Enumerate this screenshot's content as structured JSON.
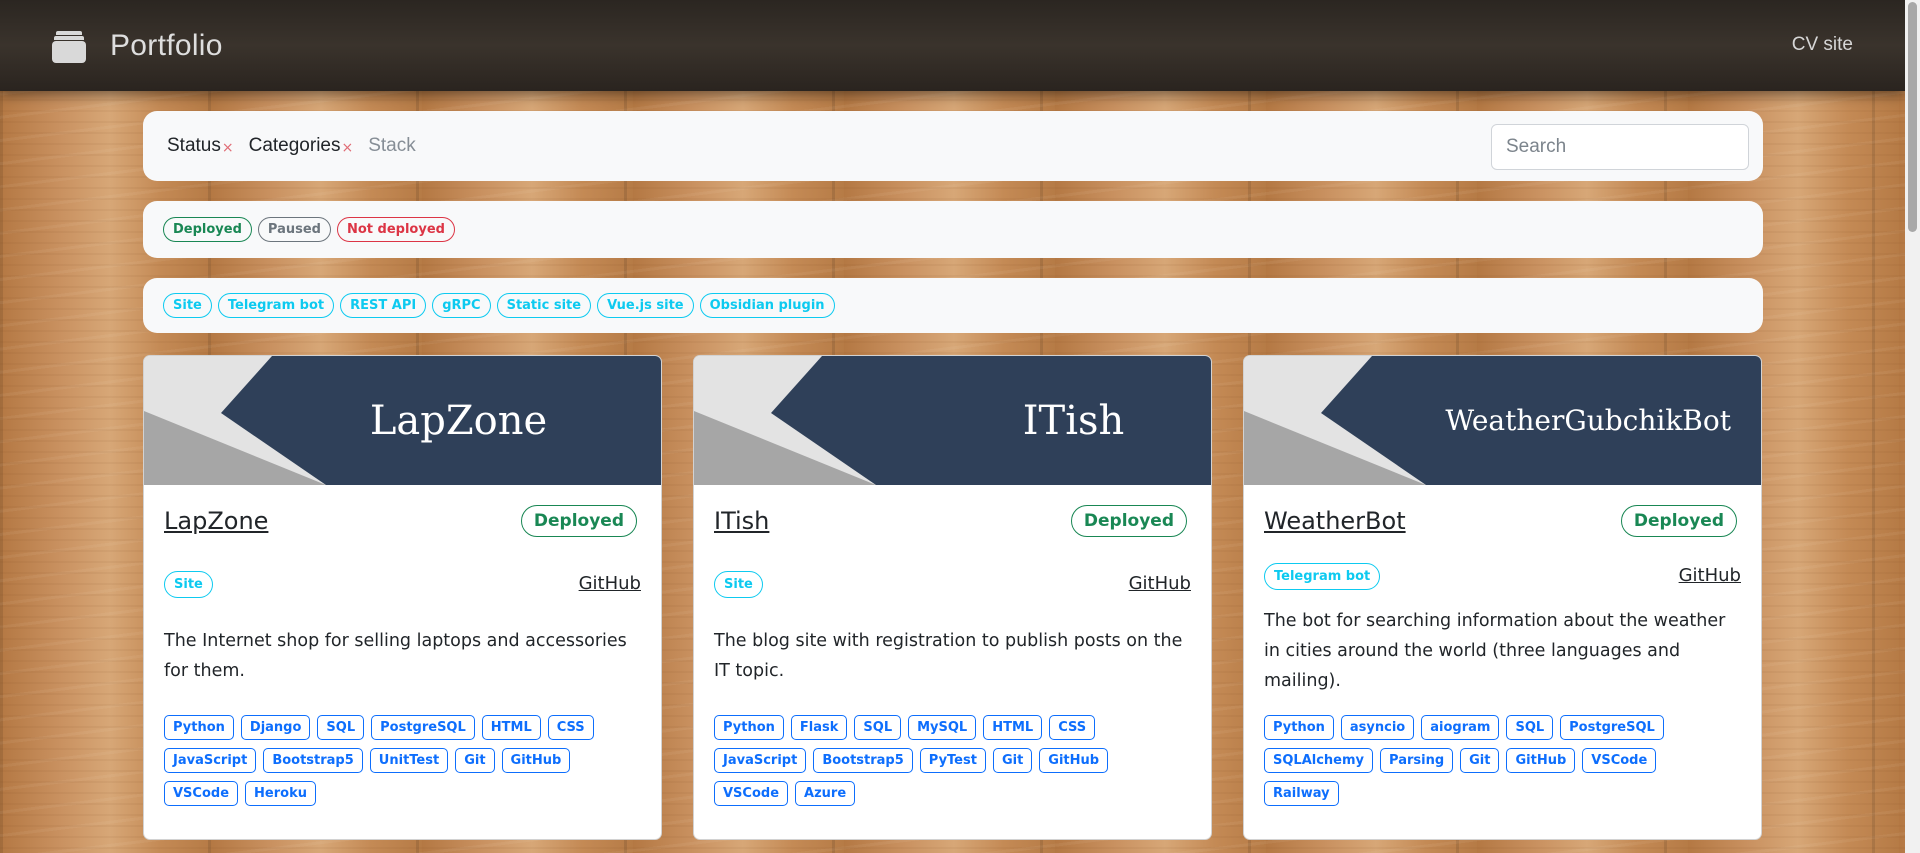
{
  "navbar": {
    "brand": "Portfolio",
    "brand_icon": "layers-icon",
    "link": "CV site"
  },
  "filters": {
    "status_label": "Status",
    "categories_label": "Categories",
    "stack_label": "Stack",
    "clear_mark": "×",
    "search_placeholder": "Search"
  },
  "status_options": [
    "Deployed",
    "Paused",
    "Not deployed"
  ],
  "category_options": [
    "Site",
    "Telegram bot",
    "REST API",
    "gRPC",
    "Static site",
    "Vue.js site",
    "Obsidian plugin"
  ],
  "colors": {
    "banner_dark": "#2f4059",
    "banner_light": "#e3e3e3",
    "banner_mid": "#a6a6a6",
    "deployed": "#198754",
    "paused": "#6c757d",
    "not_deployed": "#dc3545",
    "category": "#0dcaf0",
    "tech": "#0d6efd"
  },
  "cards": [
    {
      "banner_title": "LapZone",
      "title": "LapZone",
      "status": "Deployed",
      "category": "Site",
      "link": "GitHub",
      "description": "The Internet shop for selling laptops and accessories for them.",
      "tags": [
        "Python",
        "Django",
        "SQL",
        "PostgreSQL",
        "HTML",
        "CSS",
        "JavaScript",
        "Bootstrap5",
        "UnitTest",
        "Git",
        "GitHub",
        "VSCode",
        "Heroku"
      ]
    },
    {
      "banner_title": "ITish",
      "title": "ITish",
      "status": "Deployed",
      "category": "Site",
      "link": "GitHub",
      "description": "The blog site with registration to publish posts on the IT topic.",
      "tags": [
        "Python",
        "Flask",
        "SQL",
        "MySQL",
        "HTML",
        "CSS",
        "JavaScript",
        "Bootstrap5",
        "PyTest",
        "Git",
        "GitHub",
        "VSCode",
        "Azure"
      ]
    },
    {
      "banner_title": "WeatherGubchikBot",
      "title": "WeatherBot",
      "status": "Deployed",
      "category": "Telegram bot",
      "link": "GitHub",
      "description": "The bot for searching information about the weather in cities around the world (three languages and mailing).",
      "tags": [
        "Python",
        "asyncio",
        "aiogram",
        "SQL",
        "PostgreSQL",
        "SQLAlchemy",
        "Parsing",
        "Git",
        "GitHub",
        "VSCode",
        "Railway"
      ]
    }
  ]
}
